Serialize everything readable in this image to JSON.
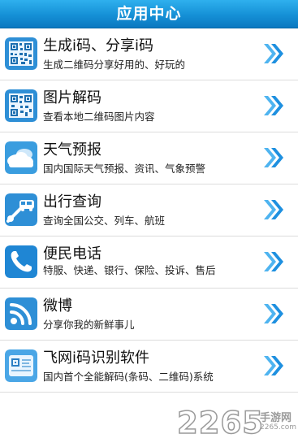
{
  "header": {
    "title": "应用中心"
  },
  "items": [
    {
      "title": "生成i码、分享i码",
      "desc": "生成二维码分享好用的、好玩的",
      "icon": "qr-code-icon"
    },
    {
      "title": "图片解码",
      "desc": "查看本地二维码图片内容",
      "icon": "qr-image-icon"
    },
    {
      "title": "天气预报",
      "desc": "国内国际天气预报、资讯、气象预警",
      "icon": "weather-cloud-icon"
    },
    {
      "title": "出行查询",
      "desc": "查询全国公交、列车、航班",
      "icon": "travel-pin-icon"
    },
    {
      "title": "便民电话",
      "desc": "特服、快递、银行、保险、投诉、售后",
      "icon": "phone-icon"
    },
    {
      "title": "微博",
      "desc": "分享你我的新鲜事儿",
      "icon": "rss-icon"
    },
    {
      "title": "飞网i码识别软件",
      "desc": "国内首个全能解码(条码、二维码)系统",
      "icon": "scanner-card-icon"
    }
  ],
  "watermark": {
    "number": "2265",
    "text": "手游网",
    "url": "2265.com"
  },
  "colors": {
    "header": "#1590d6",
    "accent": "#2a9ee6"
  }
}
